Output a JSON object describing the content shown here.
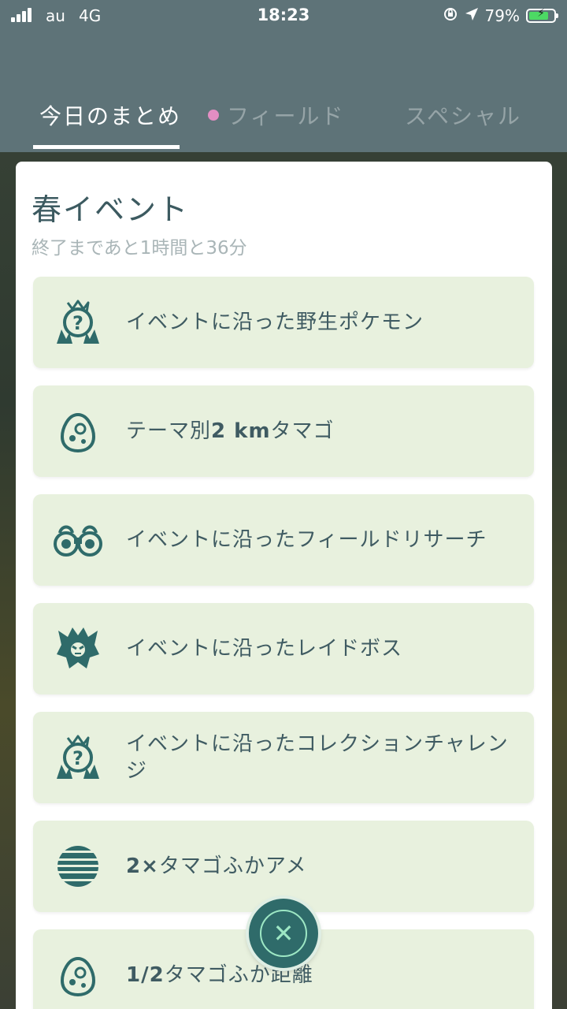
{
  "status_bar": {
    "carrier": "au",
    "network": "4G",
    "time": "18:23",
    "battery_percent": "79%",
    "battery_level": 0.79,
    "icons": [
      "signal-icon",
      "rotation-lock-icon",
      "location-icon",
      "battery-charging-icon"
    ]
  },
  "tabs": [
    {
      "label": "今日のまとめ",
      "active": true
    },
    {
      "label": "フィールド",
      "active": false,
      "indicator_color": "#e38ec3"
    },
    {
      "label": "スペシャル",
      "active": false
    }
  ],
  "event": {
    "title": "春イベント",
    "subtitle": "終了まであと1時間と36分"
  },
  "bonuses": [
    {
      "icon": "wild-pokemon-icon",
      "text": "イベントに沿った野生ポケモン"
    },
    {
      "icon": "egg-icon",
      "bold_prefix": "",
      "text_a": "テーマ別",
      "bold_mid": "2 km",
      "text_b": "タマゴ"
    },
    {
      "icon": "binoculars-icon",
      "text": "イベントに沿ったフィールドリサーチ"
    },
    {
      "icon": "raid-boss-icon",
      "text": "イベントに沿ったレイドボス"
    },
    {
      "icon": "collection-challenge-icon",
      "text": "イベントに沿ったコレクションチャレンジ"
    },
    {
      "icon": "incubator-candy-icon",
      "bold_prefix": "2×",
      "text": " タマゴふかアメ"
    },
    {
      "icon": "egg-icon",
      "bold_prefix": "1/2",
      "text": " タマゴふか距離"
    }
  ],
  "close_button": {
    "icon": "close-icon",
    "glyph": "✕"
  },
  "colors": {
    "header_bg": "#5e7378",
    "card_item_bg": "#e8f1de",
    "icon_color": "#2f6b6a",
    "text_color": "#3f5b62"
  }
}
